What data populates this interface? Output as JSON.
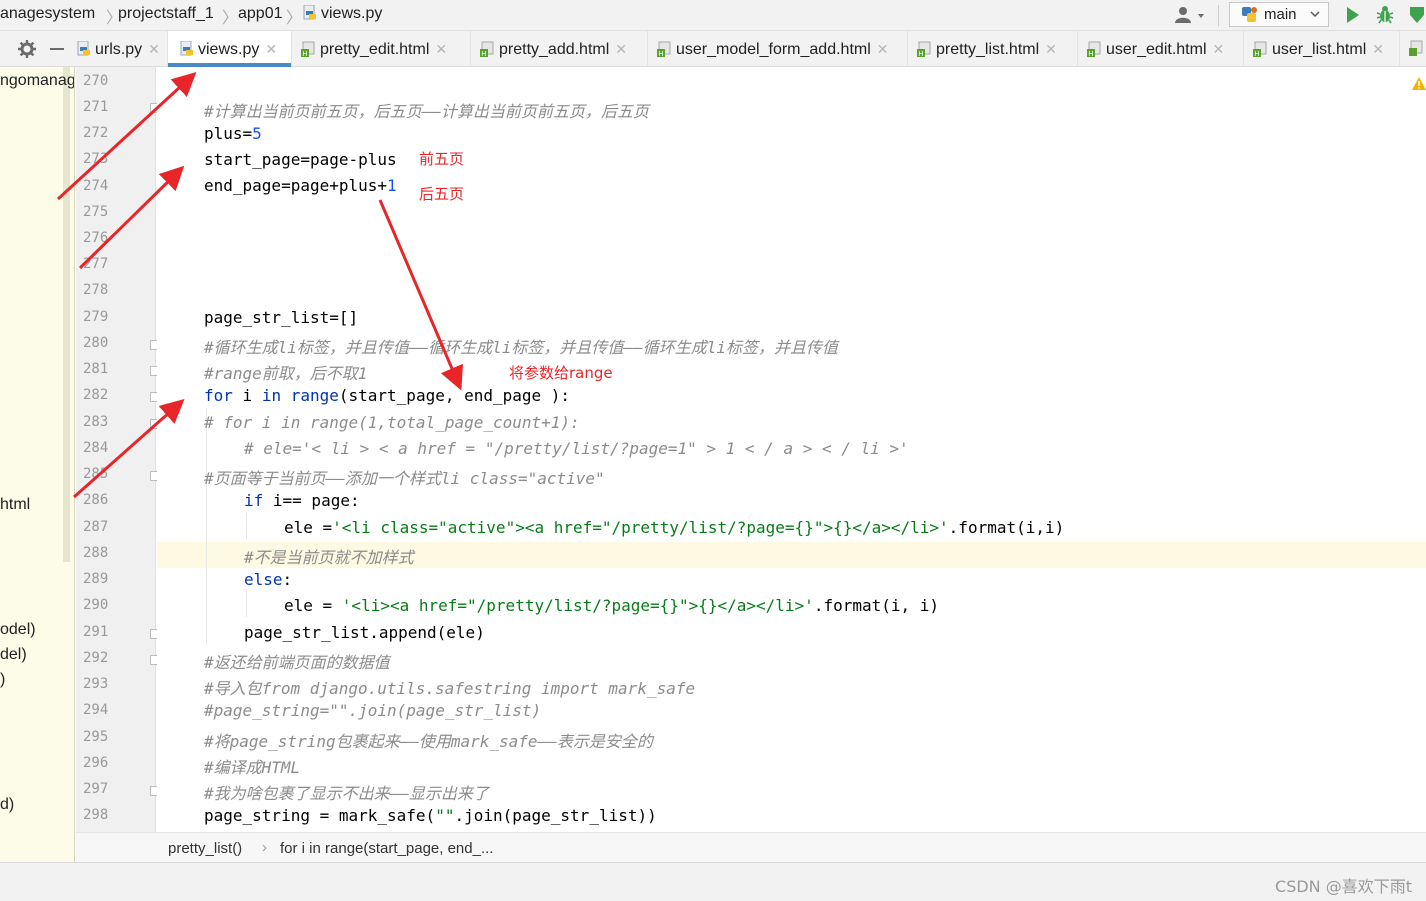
{
  "breadcrumb": [
    "anagesystem",
    "projectstaff_1",
    "app01",
    "views.py"
  ],
  "run_config": {
    "label": "main"
  },
  "tabs": [
    {
      "label": "urls.py",
      "active": false
    },
    {
      "label": "views.py",
      "active": true
    },
    {
      "label": "pretty_edit.html",
      "active": false
    },
    {
      "label": "pretty_add.html",
      "active": false
    },
    {
      "label": "user_model_form_add.html",
      "active": false
    },
    {
      "label": "pretty_list.html",
      "active": false
    },
    {
      "label": "user_edit.html",
      "active": false
    },
    {
      "label": "user_list.html",
      "active": false
    }
  ],
  "project_panel": {
    "items": [
      "ngomanage",
      "html",
      "odel)",
      "del)",
      ")",
      "d)"
    ]
  },
  "line_numbers": [
    "270",
    "271",
    "272",
    "273",
    "274",
    "275",
    "276",
    "277",
    "278",
    "279",
    "280",
    "281",
    "282",
    "283",
    "284",
    "285",
    "286",
    "287",
    "288",
    "289",
    "290",
    "291",
    "292",
    "293",
    "294",
    "295",
    "296",
    "297",
    "298"
  ],
  "code": {
    "l271": "#计算出当前页前五页，后五页——计算出当前页前五页，后五页",
    "l272a": "plus=",
    "l272b": "5",
    "l273": "start_page=page-plus",
    "l274a": "end_page=page+plus+",
    "l274b": "1",
    "l279": "page_str_list=[]",
    "l280": "#循环生成li标签，并且传值——循环生成li标签，并且传值——循环生成li标签，并且传值",
    "l281": "#range前取，后不取1",
    "l282a": "for",
    "l282b": " i ",
    "l282c": "in",
    "l282d": " range",
    "l282e": "(start_page, end_page ):",
    "l283": "# for i in range(1,total_page_count+1):",
    "l284": "# ele='< li > < a href = \"/pretty/list/?page=1\" > 1 < / a > < / li >'",
    "l285": "#页面等于当前页——添加一个样式li class=\"active\"",
    "l286a": "if",
    "l286b": " i== page:",
    "l287a": "ele =",
    "l287b": "'<li class=\"active\"><a href=\"/pretty/list/?page={}\">{}</a></li>'",
    "l287c": ".format(i,i)",
    "l288": "#不是当前页就不加样式",
    "l289a": "else",
    "l289b": ":",
    "l290a": "ele = ",
    "l290b": "'<li><a href=\"/pretty/list/?page={}\">{}</a></li>'",
    "l290c": ".format(i, i)",
    "l291": "page_str_list.append(ele)",
    "l292": "#返还给前端页面的数据值",
    "l293": "#导入包from django.utils.safestring import mark_safe",
    "l294": "#page_string=\"\".join(page_str_list)",
    "l295": "#将page_string包裹起来——使用mark_safe——表示是安全的",
    "l296": "#编译成HTML",
    "l297": "#我为啥包裹了显示不出来——显示出来了",
    "l298a": "page_string = mark_safe(",
    "l298b": "\"\"",
    "l298c": ".join(page_str_list))"
  },
  "annotations": {
    "prev5": "前五页",
    "next5": "后五页",
    "range": "将参数给range"
  },
  "code_breadcrumb": [
    "pretty_list()",
    "for i in range(start_page, end_..."
  ],
  "watermark": "CSDN @喜欢下雨t",
  "colors": {
    "annotation": "#e8262a",
    "active_tab_underline": "#4a88c7",
    "current_line": "#fdf9e3"
  }
}
